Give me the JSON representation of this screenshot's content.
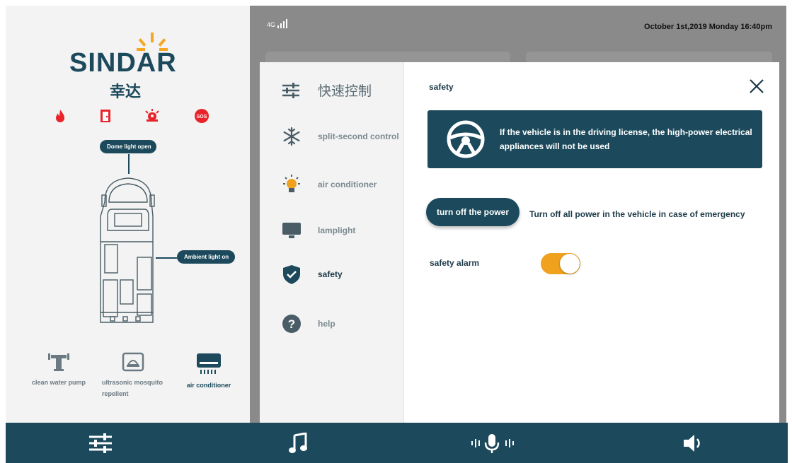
{
  "left_panel": {
    "logo_text": "SINDAR",
    "logo_cn": "幸达",
    "alert_icons": [
      "fire-icon",
      "exit-door-icon",
      "alarm-siren-icon",
      "sos-icon"
    ],
    "callouts": {
      "dome": "Dome light open",
      "ambient": "Ambient light on"
    },
    "features": [
      {
        "icon": "water-pump-icon",
        "label": "clean water pump"
      },
      {
        "icon": "ultrasonic-icon",
        "label": "ultrasonic mosquito repellent"
      },
      {
        "icon": "air-conditioner-icon",
        "label": "air conditioner"
      }
    ]
  },
  "status_bar": {
    "network": "4G",
    "datetime": "October 1st,2019 Monday 16:40pm"
  },
  "menu": {
    "header": "快速控制",
    "items": [
      {
        "icon": "snowflake-icon",
        "label": "split-second control"
      },
      {
        "icon": "light-bulb-icon",
        "label": "air conditioner"
      },
      {
        "icon": "monitor-icon",
        "label": "lamplight"
      },
      {
        "icon": "shield-check-icon",
        "label": "safety",
        "active": true
      },
      {
        "icon": "help-icon",
        "label": "help"
      }
    ]
  },
  "content": {
    "title": "safety",
    "banner_text": "If the vehicle is in the driving license, the high-power electrical appliances will not be used",
    "power_button": "turn off the power",
    "power_desc": "Turn off all power in the vehicle in case of emergency",
    "alarm_label": "safety alarm",
    "alarm_on": true
  },
  "bottom_bar": [
    "sliders-icon",
    "music-note-icon",
    "voice-mic-icon",
    "speaker-icon"
  ],
  "colors": {
    "primary": "#1c4a5c",
    "accent": "#f0a21e",
    "alert": "#e8232a"
  }
}
